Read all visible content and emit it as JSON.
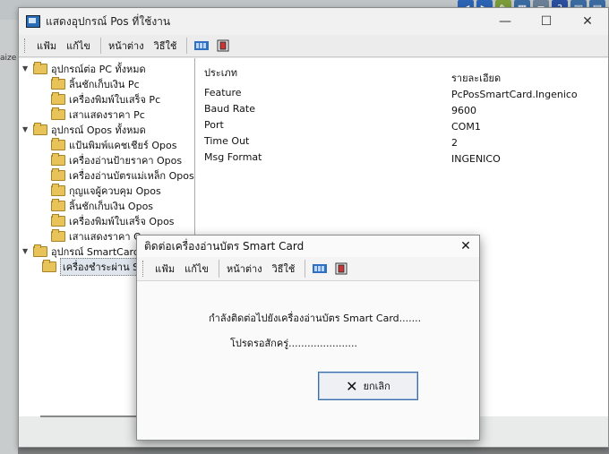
{
  "window": {
    "title": "แสดงอุปกรณ์ Pos ที่ใช้งาน",
    "minimize": "—",
    "maximize": "☐",
    "close": "✕"
  },
  "menu": [
    "แฟ้ม",
    "แก้ไข",
    "หน้าต่าง",
    "วิธีใช้"
  ],
  "left_edge_text": "aize",
  "tree": [
    {
      "label": "อุปกรณ์ต่อ PC ทั้งหมด",
      "level": 0,
      "expanded": true
    },
    {
      "label": "ลิ้นชักเก็บเงิน Pc",
      "level": 1
    },
    {
      "label": "เครื่องพิมพ์ใบเสร็จ Pc",
      "level": 1
    },
    {
      "label": "เสาแสดงราคา Pc",
      "level": 1
    },
    {
      "label": "อุปกรณ์ Opos ทั้งหมด",
      "level": 0,
      "expanded": true
    },
    {
      "label": "แป้นพิมพ์แคชเชียร์ Opos",
      "level": 1
    },
    {
      "label": "เครื่องอ่านป้ายราคา Opos",
      "level": 1
    },
    {
      "label": "เครื่องอ่านบัตรแม่เหล็ก Opos",
      "level": 1
    },
    {
      "label": "กุญแจผู้ควบคุม Opos",
      "level": 1
    },
    {
      "label": "ลิ้นชักเก็บเงิน Opos",
      "level": 1
    },
    {
      "label": "เครื่องพิมพ์ใบเสร็จ Opos",
      "level": 1
    },
    {
      "label": "เสาแสดงราคา Opos",
      "level": 1
    },
    {
      "label": "อุปกรณ์ SmartCard",
      "level": 0,
      "expanded": true
    },
    {
      "label": "เครื่องชำระผ่าน Smart Card",
      "level": 1,
      "selected": true
    }
  ],
  "details": {
    "header_type": "ประเภท",
    "header_detail": "รายละเอียด",
    "rows": [
      {
        "name": "Feature",
        "value": "PcPosSmartCard.Ingenico"
      },
      {
        "name": "Baud Rate",
        "value": "9600"
      },
      {
        "name": "Port",
        "value": "COM1"
      },
      {
        "name": "Time Out",
        "value": "2"
      },
      {
        "name": "Msg Format",
        "value": "INGENICO"
      }
    ]
  },
  "dialog": {
    "title": "ติดต่อเครื่องอ่านบัตร Smart Card",
    "close": "✕",
    "message1": "กำลังติดต่อไปยังเครื่องอ่านบัตร Smart Card.......",
    "message2": "โปรดรอสักครู่......................",
    "cancel_label": "ยกเลิก",
    "cancel_icon": "✕"
  },
  "colors": {
    "folder": "#e7c35a",
    "accent": "#3d6ea8"
  }
}
